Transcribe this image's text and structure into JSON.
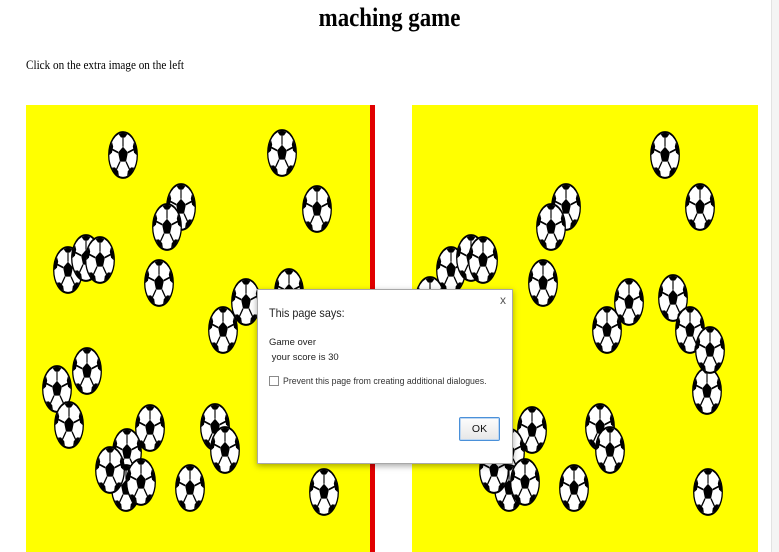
{
  "page": {
    "title": "maching game",
    "instructions": "Click on the extra image on the left"
  },
  "colors": {
    "board": "#ffff00",
    "divider": "#e10000",
    "ball_fill": "#ffffff",
    "ball_patch": "#000000"
  },
  "boards": {
    "left": {
      "ball_icon": "soccer-ball-icon",
      "ball_count": 26
    },
    "right": {
      "ball_icon": "soccer-ball-icon",
      "ball_count": 25
    }
  },
  "dialog": {
    "title": "This page says:",
    "message_line1": "Game over",
    "message_line2": " your score is 30",
    "checkbox_label": "Prevent this page from creating additional dialogues.",
    "checkbox_checked": false,
    "ok_label": "OK",
    "close_label": "x"
  }
}
